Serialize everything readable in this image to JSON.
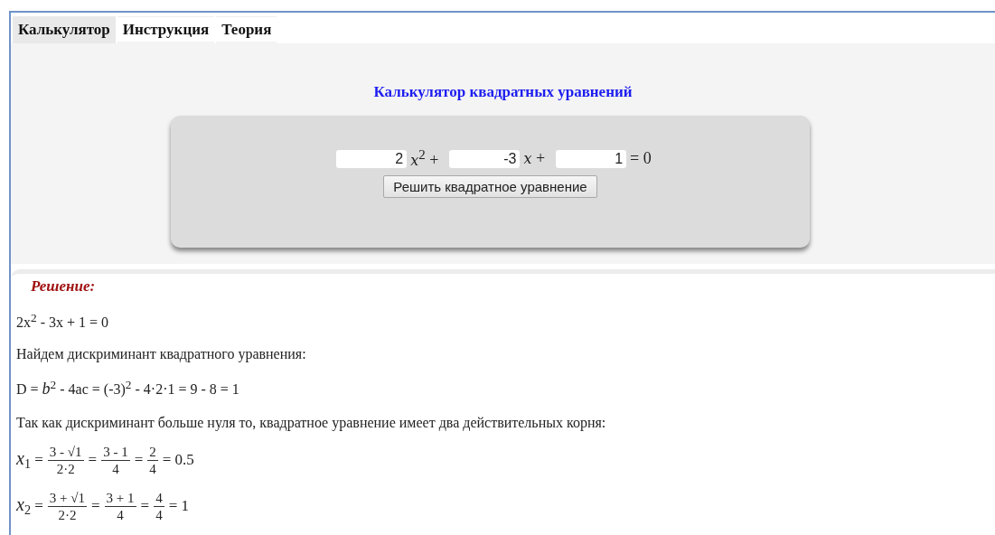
{
  "tabs": [
    {
      "label": "Калькулятор",
      "selected": true
    },
    {
      "label": "Инструкция",
      "selected": false
    },
    {
      "label": "Теория",
      "selected": false
    }
  ],
  "calculator": {
    "title": "Калькулятор квадратных уравнений",
    "terms": [
      {
        "value": "2",
        "suffix": "*x*$^{2}$ +"
      },
      {
        "value": "-3",
        "suffix": "*x* +"
      },
      {
        "value": "1",
        "suffix": "= 0"
      }
    ],
    "button": "Решить квадратное уравнение"
  },
  "solution": {
    "heading": "Решение:",
    "lines": [
      {
        "kind": "text",
        "text": "2x$^{2}$ - 3x + 1 = 0"
      },
      {
        "kind": "text",
        "text": "Найдем дискриминант квадратного уравнения:"
      },
      {
        "kind": "text",
        "text": "D = *b*$^{2}$ - 4ac = (-3)$^{2}$ - 4·2·1 = 9 - 8 = 1"
      },
      {
        "kind": "text",
        "text": "Так как дискриминант больше нуля то, квадратное уравнение имеет два действительных корня:"
      },
      {
        "kind": "formula",
        "lhs": "*x*$_{1}$ =",
        "parts": [
          {
            "kind": "frac",
            "num": "3 - √1",
            "den": "2·2"
          },
          {
            "kind": "op",
            "text": "="
          },
          {
            "kind": "frac",
            "num": "3 - 1",
            "den": "4"
          },
          {
            "kind": "op",
            "text": "="
          },
          {
            "kind": "frac",
            "num": "2",
            "den": "4"
          },
          {
            "kind": "op",
            "text": "= 0.5"
          }
        ]
      },
      {
        "kind": "formula",
        "lhs": "*x*$_{2}$ =",
        "parts": [
          {
            "kind": "frac",
            "num": "3 + √1",
            "den": "2·2"
          },
          {
            "kind": "op",
            "text": "="
          },
          {
            "kind": "frac",
            "num": "3 + 1",
            "den": "4"
          },
          {
            "kind": "op",
            "text": "="
          },
          {
            "kind": "frac",
            "num": "4",
            "den": "4"
          },
          {
            "kind": "op",
            "text": "= 1"
          }
        ]
      }
    ]
  }
}
